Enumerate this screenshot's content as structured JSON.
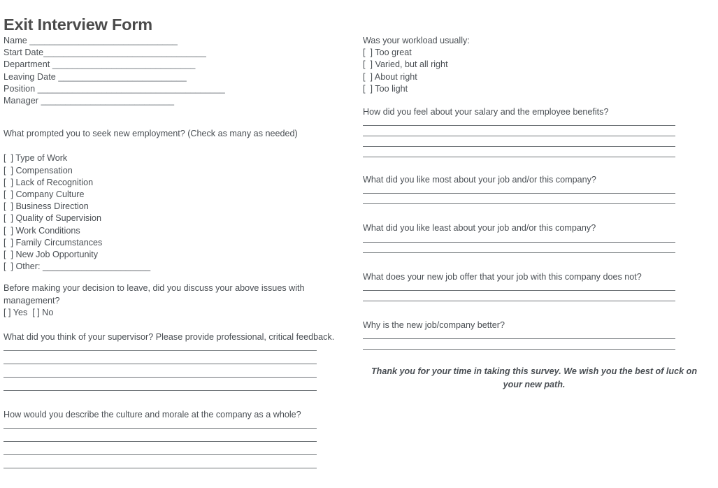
{
  "title": "Exit Interview Form",
  "identity_fields": [
    {
      "label": "Name ",
      "rule": "______________________________"
    },
    {
      "label": "Start Date",
      "rule": "_________________________________"
    },
    {
      "label": "Department ",
      "rule": "_____________________________"
    },
    {
      "label": "Leaving Date ",
      "rule": "__________________________"
    },
    {
      "label": "Position ",
      "rule": "______________________________________"
    },
    {
      "label": "Manager ",
      "rule": "___________________________"
    }
  ],
  "left_column": {
    "reasons_question": "What prompted you to seek new employment? (Check as many as needed)",
    "reasons_options": [
      "[  ] Type of Work",
      "[  ] Compensation",
      "[  ] Lack of Recognition",
      "[  ] Company Culture",
      "[  ] Business Direction",
      "[  ] Quality of Supervision",
      "[  ] Work Conditions",
      "[  ] Family Circumstances",
      "[  ] New Job Opportunity"
    ],
    "other_option": "[  ] Other: ______________________",
    "discuss_question": "Before making your decision to leave, did you discuss your above issues with management?",
    "discuss_options": "[ ] Yes  [ ] No",
    "supervisor_question": "What did you think of your supervisor? Please provide professional, critical feedback.",
    "supervisor_answer_lines": 4,
    "culture_question": "How would you describe the culture and morale at the company as a whole?",
    "culture_answer_lines": 4
  },
  "right_column": {
    "workload_question": "Was your workload usually:",
    "workload_options": [
      "[  ] Too great",
      "[  ] Varied, but all right",
      "[  ] About right",
      "[  ] Too light"
    ],
    "salary_question": "How did you feel about your salary and the employee benefits?",
    "salary_answer_lines": 4,
    "like_most_question": "What did you like most about your job and/or this company?",
    "like_most_answer_lines": 2,
    "like_least_question": "What did you like least about your job and/or this company?",
    "like_least_answer_lines": 2,
    "new_job_offer_question": "What does your new job offer that your job with this company does not?",
    "new_job_offer_answer_lines": 2,
    "why_better_question": "Why is the new job/company better?",
    "why_better_answer_lines": 2,
    "closing_note": "Thank you for your time in taking this survey. We wish you the best of luck on your new path."
  },
  "colors": {
    "text": "#4a4f54",
    "title": "#4b4b4b",
    "rule": "#6f7478",
    "background": "#ffffff"
  }
}
